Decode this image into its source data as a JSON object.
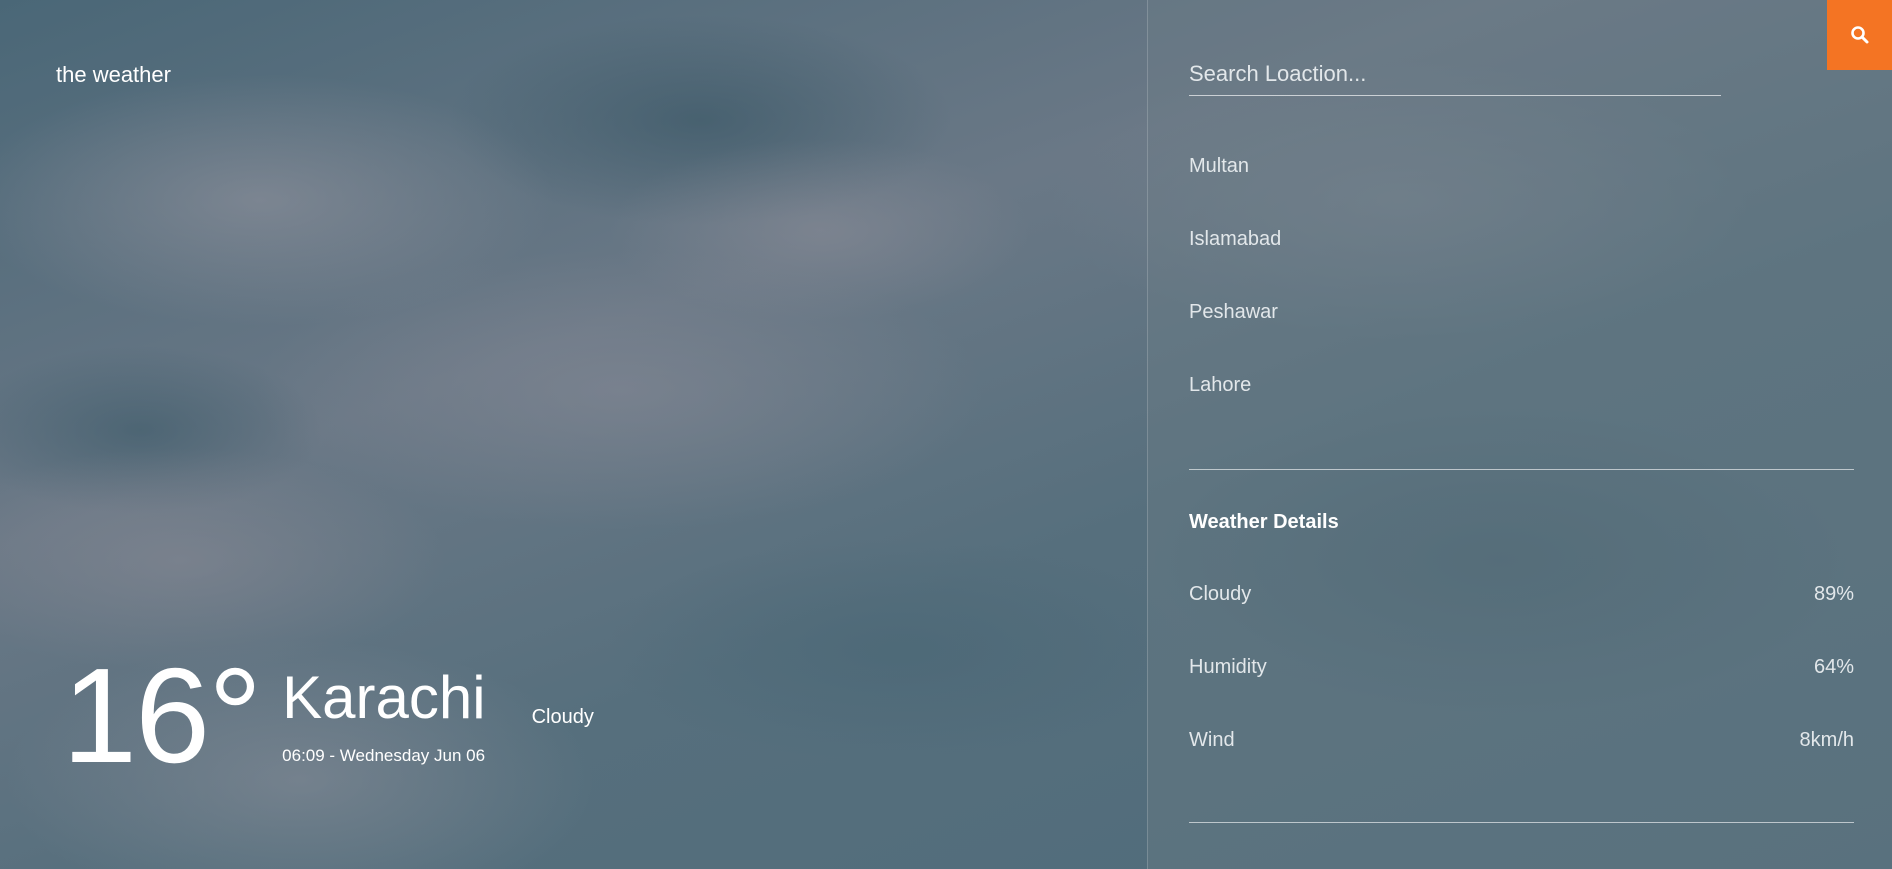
{
  "brand": "the weather",
  "current": {
    "temperature": "16°",
    "city": "Karachi",
    "datetime": "06:09 - Wednesday Jun 06",
    "condition": "Cloudy"
  },
  "search": {
    "placeholder": "Search Loaction...",
    "value": "",
    "button_icon": "search-icon"
  },
  "cities": [
    "Multan",
    "Islamabad",
    "Peshawar",
    "Lahore"
  ],
  "details": {
    "title": "Weather Details",
    "rows": [
      {
        "label": "Cloudy",
        "value": "89%"
      },
      {
        "label": "Humidity",
        "value": "64%"
      },
      {
        "label": "Wind",
        "value": "8km/h"
      }
    ]
  },
  "colors": {
    "accent": "#f47423"
  }
}
